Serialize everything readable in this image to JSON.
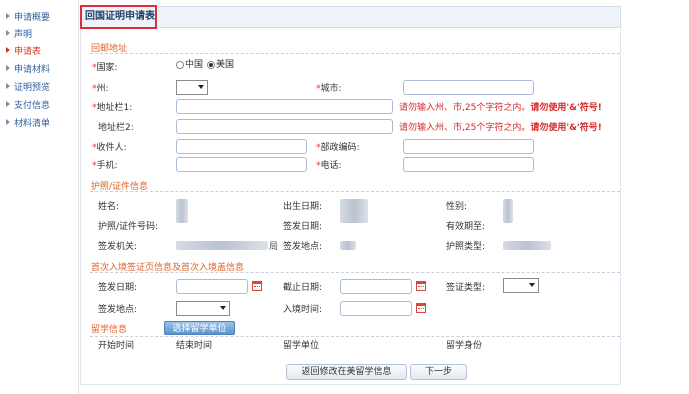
{
  "sidebar": {
    "items": [
      {
        "label": "申请概要",
        "active": false
      },
      {
        "label": "声明",
        "active": false
      },
      {
        "label": "申请表",
        "active": true
      },
      {
        "label": "申请材料",
        "active": false
      },
      {
        "label": "证明预览",
        "active": false
      },
      {
        "label": "支付信息",
        "active": false
      },
      {
        "label": "材料清单",
        "active": false
      }
    ]
  },
  "page": {
    "title": "回国证明申请表"
  },
  "mailing_address": {
    "section_title": "回邮地址",
    "required_mark": "*",
    "country_label": "国家:",
    "country_options": [
      "中国",
      "美国"
    ],
    "country_selected": "美国",
    "state_label": "州:",
    "city_label": "城市:",
    "address1_label": "地址栏1:",
    "address2_label": "地址栏2:",
    "hint_text": "请勿输入州、市,25个字符之内。",
    "hint_bold": "请勿使用'&'符号!",
    "recipient_label": "收件人:",
    "zip_label": "部政编码:",
    "mobile_label": "手机:",
    "phone_label": "电话:"
  },
  "passport": {
    "section_title": "护照/证件信息",
    "name_label": "姓名:",
    "birth_label": "出生日期:",
    "gender_label": "性别:",
    "number_label": "护照/证件号码:",
    "issue_date_label": "签发日期:",
    "expiry_label": "有效期至:",
    "authority_label": "签发机关:",
    "authority_suffix": "局",
    "place_label": "签发地点:",
    "type_label": "护照类型:"
  },
  "visa": {
    "section_title": "首次入境签证页信息及首次入境盖信息",
    "issue_date_label": "签发日期:",
    "deadline_label": "截止日期:",
    "visa_type_label": "签证类型:",
    "place_label": "签发地点:",
    "entry_time_label": "入境时间:"
  },
  "study": {
    "section_title": "留学信息",
    "select_button": "选择留学单位",
    "columns": [
      "开始时间",
      "结束时间",
      "留学单位",
      "留学身份"
    ]
  },
  "footer": {
    "back_button": "返回修改在美留学信息",
    "next_button": "下一步"
  },
  "colors": {
    "accent_red": "#d9303a",
    "section_orange": "#e0632a",
    "link_blue": "#2f5f9c",
    "button_blue": "#5c93cc"
  }
}
